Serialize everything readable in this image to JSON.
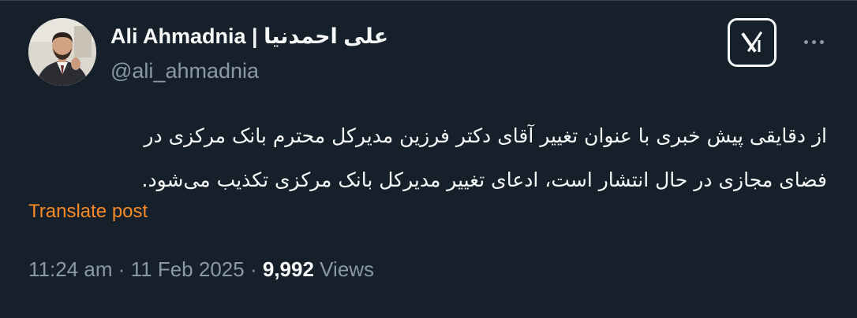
{
  "author": {
    "display_name": "Ali Ahmadnia | علی احمدنیا",
    "handle": "@ali_ahmadnia"
  },
  "header_icons": {
    "grok_icon": "grok-icon",
    "more_icon": "more-horizontal-icon"
  },
  "tweet": {
    "line_1": "از دقایقی پیش خبری با عنوان تغییر آقای دکتر فرزین مدیرکل محترم بانک مرکزی در",
    "line_2": "فضای مجازی در حال انتشار است، ادعای تغییر مدیرکل بانک مرکزی تکذیب می‌شود."
  },
  "translate_label": "Translate post",
  "meta": {
    "time": "11:24 am",
    "separator_1": "·",
    "date": "11 Feb 2025",
    "separator_2": "·",
    "views_count": "9,992",
    "views_label": "Views"
  },
  "colors": {
    "background": "#15202b",
    "primary_text": "#f7f9f9",
    "secondary_text": "#8b98a5",
    "translate_link": "#f78a26"
  }
}
